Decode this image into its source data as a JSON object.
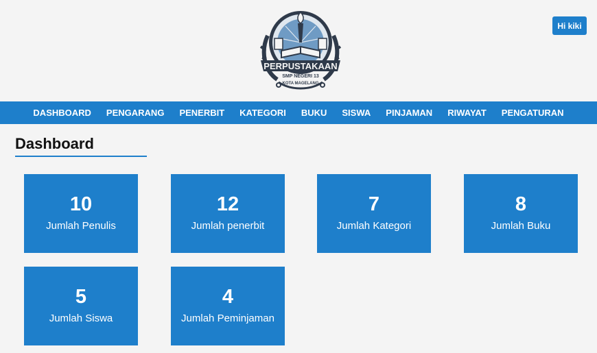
{
  "header": {
    "logo": {
      "title": "PERPUSTAKAAN",
      "subtitle": "SMP NEGERI 13",
      "kota": "KOTA",
      "city": "KOTA MAGELANG"
    },
    "user_label": "Hi kiki"
  },
  "nav": {
    "items": [
      "DASHBOARD",
      "PENGARANG",
      "PENERBIT",
      "KATEGORI",
      "BUKU",
      "SISWA",
      "PINJAMAN",
      "RIWAYAT",
      "PENGATURAN"
    ]
  },
  "main": {
    "title": "Dashboard",
    "cards": [
      {
        "value": "10",
        "label": "Jumlah Penulis"
      },
      {
        "value": "12",
        "label": "Jumlah penerbit"
      },
      {
        "value": "7",
        "label": "Jumlah Kategori"
      },
      {
        "value": "8",
        "label": "Jumlah Buku"
      },
      {
        "value": "5",
        "label": "Jumlah Siswa"
      },
      {
        "value": "4",
        "label": "Jumlah Peminjaman"
      }
    ]
  },
  "colors": {
    "primary": "#1e7fcb",
    "background": "#f4f4f4",
    "logo_dark": "#2f3a4a",
    "logo_light": "#dfe7ef"
  }
}
